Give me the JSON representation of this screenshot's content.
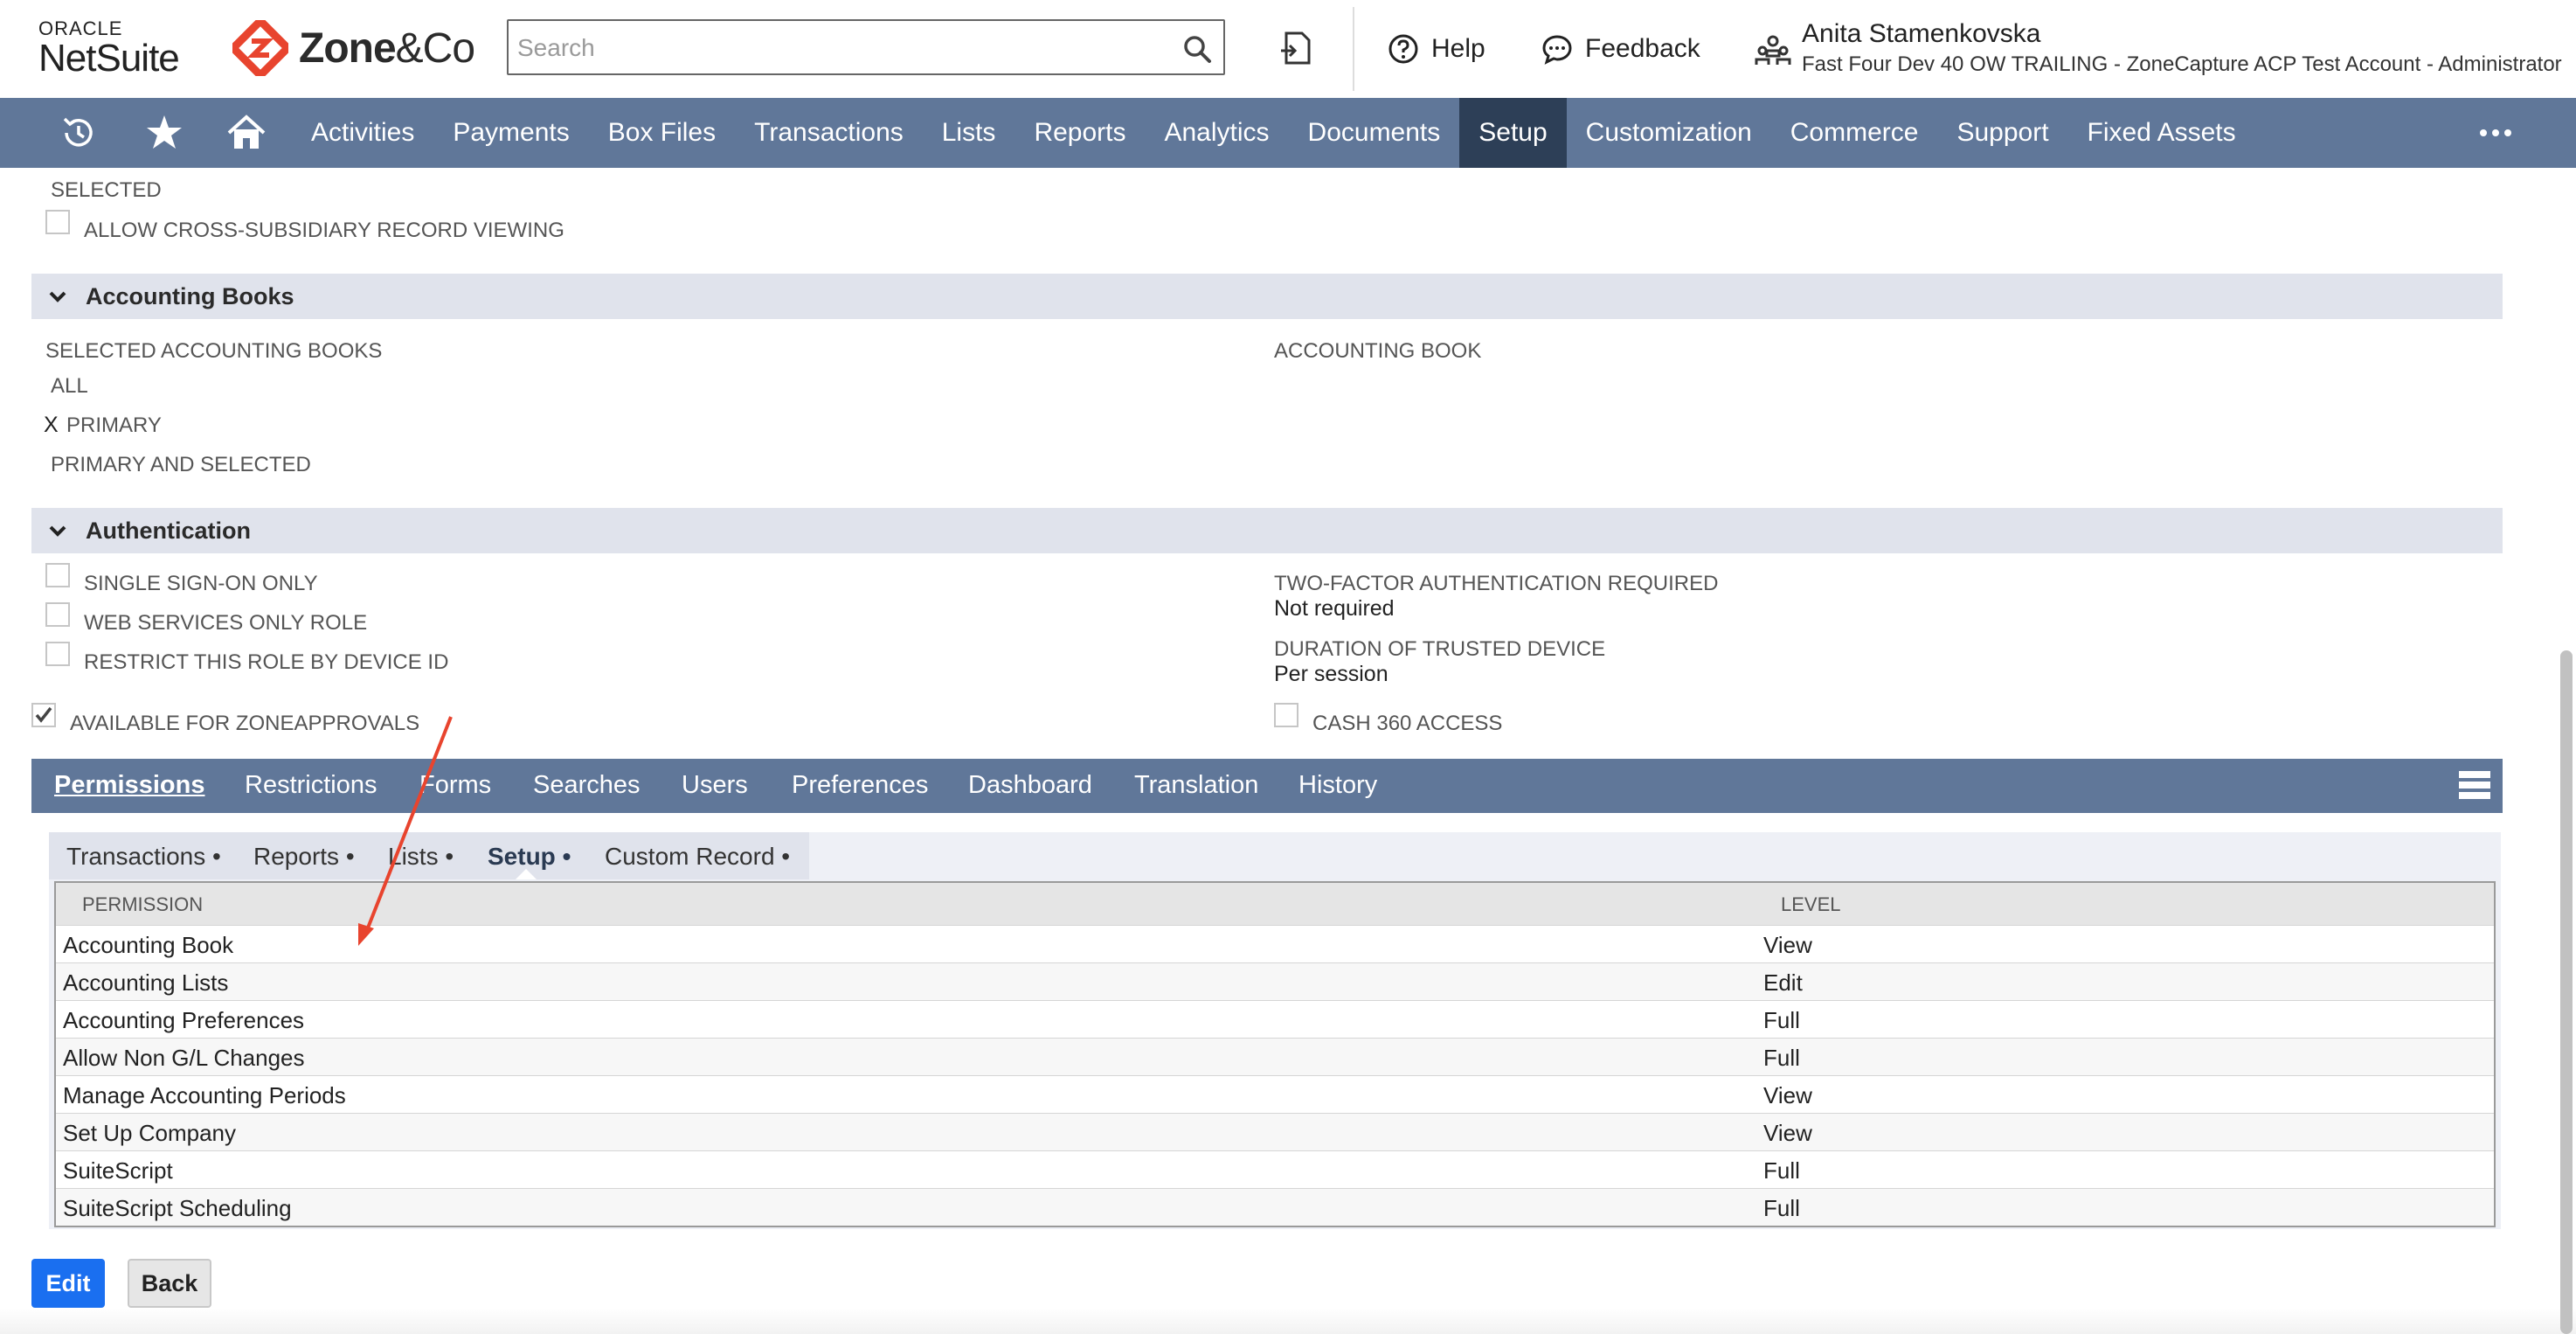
{
  "header": {
    "oracle_small": "ORACLE",
    "netsuite": "NetSuite",
    "zone_brand": "Zone",
    "zone_brand_suffix": "&Co",
    "search_placeholder": "Search",
    "help_label": "Help",
    "feedback_label": "Feedback",
    "user_name": "Anita Stamenkovska",
    "user_account": "Fast Four Dev 40 OW TRAILING - ZoneCapture ACP Test Account - Administrator"
  },
  "nav": {
    "items": [
      "Activities",
      "Payments",
      "Box Files",
      "Transactions",
      "Lists",
      "Reports",
      "Analytics",
      "Documents",
      "Setup",
      "Customization",
      "Commerce",
      "Support",
      "Fixed Assets"
    ],
    "active": "Setup",
    "icons": [
      "recent-records-icon",
      "star-icon",
      "home-icon",
      "more-icon"
    ]
  },
  "top_section": {
    "selected_label": "SELECTED",
    "allow_cross_subsidiary": "ALLOW CROSS-SUBSIDIARY RECORD VIEWING"
  },
  "accounting_books": {
    "title": "Accounting Books",
    "selected_label": "SELECTED ACCOUNTING BOOKS",
    "options": [
      "ALL",
      "PRIMARY",
      "PRIMARY AND SELECTED"
    ],
    "selected_marker": "X",
    "accounting_book_label": "ACCOUNTING BOOK"
  },
  "authentication": {
    "title": "Authentication",
    "single_sign_on": "SINGLE SIGN-ON ONLY",
    "web_services": "WEB SERVICES ONLY ROLE",
    "restrict_device": "RESTRICT THIS ROLE BY DEVICE ID",
    "zoneapprovals": "AVAILABLE FOR ZONEAPPROVALS",
    "two_factor_label": "TWO-FACTOR AUTHENTICATION REQUIRED",
    "two_factor_value": "Not required",
    "trusted_device_label": "DURATION OF TRUSTED DEVICE",
    "trusted_device_value": "Per session",
    "cash360": "CASH 360 ACCESS"
  },
  "tabs": {
    "items": [
      "Permissions",
      "Restrictions",
      "Forms",
      "Searches",
      "Users",
      "Preferences",
      "Dashboard",
      "Translation",
      "History"
    ],
    "active": "Permissions"
  },
  "subtabs": {
    "items": [
      "Transactions",
      "Reports",
      "Lists",
      "Setup",
      "Custom Record"
    ],
    "bullet": "•",
    "active": "Setup"
  },
  "permissions_table": {
    "headers": [
      "PERMISSION",
      "LEVEL"
    ],
    "rows": [
      {
        "permission": "Accounting Book",
        "level": "View"
      },
      {
        "permission": "Accounting Lists",
        "level": "Edit"
      },
      {
        "permission": "Accounting Preferences",
        "level": "Full"
      },
      {
        "permission": "Allow Non G/L Changes",
        "level": "Full"
      },
      {
        "permission": "Manage Accounting Periods",
        "level": "View"
      },
      {
        "permission": "Set Up Company",
        "level": "View"
      },
      {
        "permission": "SuiteScript",
        "level": "Full"
      },
      {
        "permission": "SuiteScript Scheduling",
        "level": "Full"
      }
    ]
  },
  "buttons": {
    "edit": "Edit",
    "back": "Back"
  },
  "colors": {
    "nav_bg": "#607799",
    "nav_active": "#2d3f57",
    "section_bg": "#e0e3ec",
    "edit_button": "#1a6ff0",
    "annotation_arrow": "#e8442e",
    "zone_logo_red": "#e8442e"
  }
}
